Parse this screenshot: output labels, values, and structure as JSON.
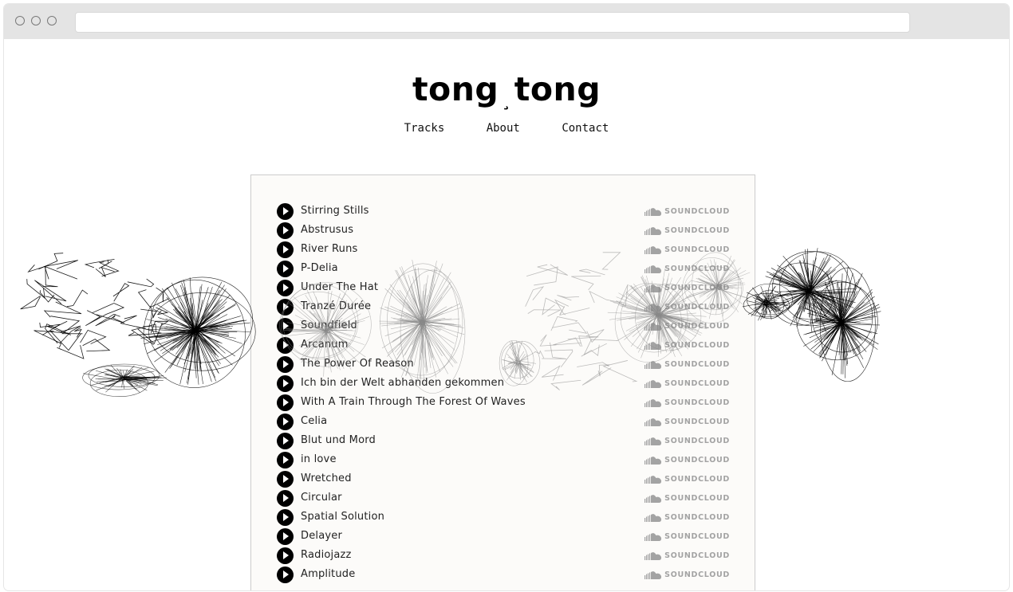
{
  "site": {
    "logo_left": "tong",
    "logo_sep": "¸",
    "logo_right": "tong"
  },
  "nav": {
    "items": [
      "Tracks",
      "About",
      "Contact"
    ]
  },
  "soundcloud_label": "SOUNDCLOUD",
  "tracks": [
    "Stirring Stills",
    "Abstrusus",
    "River Runs",
    "P-Delia",
    "Under The Hat",
    "Tranzé Durée",
    "Soundfield",
    "Arcanum",
    "The Power Of Reason",
    "Ich bin der Welt abhanden gekommen",
    "With A Train Through The Forest Of Waves",
    "Celia",
    "Blut und Mord",
    "in love",
    "Wretched",
    "Circular",
    "Spatial Solution",
    "Delayer",
    "Radiojazz",
    "Amplitude"
  ],
  "colors": {
    "panel_bg": "#fcfbf9",
    "soundcloud_grey": "#a3a3a3",
    "chrome": "#e4e4e4"
  }
}
